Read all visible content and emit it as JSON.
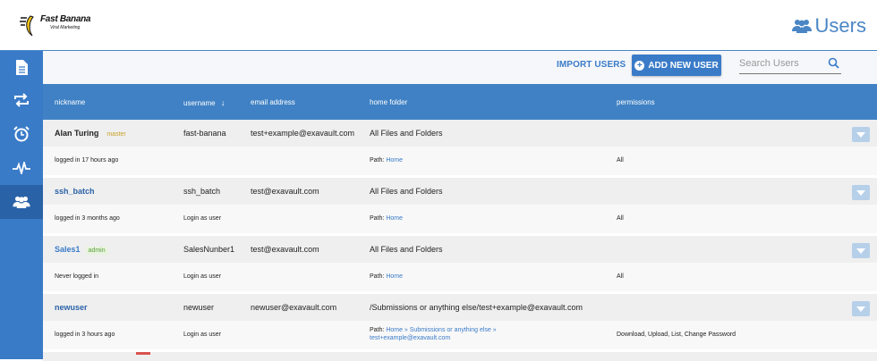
{
  "brand": {
    "name": "Fast Banana",
    "tagline": "Viral Marketing"
  },
  "header": {
    "title": "Users",
    "icon": "users-icon"
  },
  "sidebar": {
    "items": [
      {
        "name": "files",
        "icon": "document-icon"
      },
      {
        "name": "transfers",
        "icon": "sync-icon"
      },
      {
        "name": "schedule",
        "icon": "alarm-clock-icon"
      },
      {
        "name": "activity",
        "icon": "pulse-icon"
      },
      {
        "name": "users",
        "icon": "users-icon",
        "active": true
      }
    ]
  },
  "toolbar": {
    "import_label": "IMPORT USERS",
    "add_label": "ADD NEW USER",
    "search_placeholder": "Search Users"
  },
  "table": {
    "columns": [
      "nickname",
      "username",
      "email address",
      "home folder",
      "permissions"
    ],
    "sort_arrow": "↓",
    "rows": [
      {
        "nickname": "Alan Turing",
        "badge": "master",
        "username": "fast-banana",
        "email": "test+example@exavault.com",
        "home": "All Files and Folders",
        "status": "logged in 17 hours ago",
        "login_as": "",
        "path_label": "Path:",
        "path": "Home",
        "path2": "",
        "permissions": "All",
        "nick_link": false
      },
      {
        "nickname": "ssh_batch",
        "badge": "",
        "username": "ssh_batch",
        "email": "test@exavault.com",
        "home": "All Files and Folders",
        "status": "logged in 3 months ago",
        "login_as": "Login as user",
        "path_label": "Path:",
        "path": "Home",
        "path2": "",
        "permissions": "All",
        "nick_link": true
      },
      {
        "nickname": "Sales1",
        "badge": "admin",
        "username": "SalesNunber1",
        "email": "test@exavault.com",
        "home": "All Files and Folders",
        "status": "Never logged in",
        "login_as": "Login as user",
        "path_label": "Path:",
        "path": "Home",
        "path2": "",
        "permissions": "All",
        "nick_link": true
      },
      {
        "nickname": "newuser",
        "badge": "",
        "username": "newuser",
        "email": "newuser@exavault.com",
        "home": "/Submissions or anything else/test+example@exavault.com",
        "status": "logged in 3 hours ago",
        "login_as": "Login as user",
        "path_label": "Path:",
        "path": "Home » Submissions or anything else »",
        "path2": "test+example@exavault.com",
        "permissions": "Download, Upload, List, Change Password",
        "nick_link": true
      }
    ]
  },
  "colors": {
    "accent": "#3a7bc8",
    "header_bg": "#3f81c4",
    "master": "#c9a227",
    "admin": "#5aa03a"
  }
}
